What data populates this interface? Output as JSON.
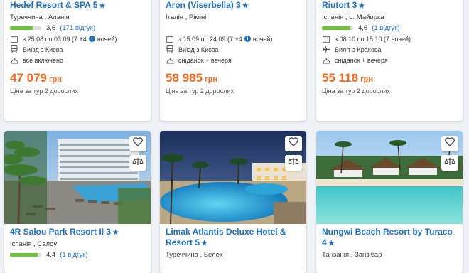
{
  "cards_top": [
    {
      "title": "Hedef Resort & SPA 5",
      "location": "Туреччина , Аланія",
      "rating": "3,6",
      "rating_fraction": 0.72,
      "reviews": "(171 відгук)",
      "dates": "з 25.08 по 03.09 (7 +4",
      "nights": "ночей)",
      "departure": "Виїзд з Києва",
      "meal": "все включено",
      "price": "47 079",
      "currency": "грн",
      "price_note": "Ціна за тур 2 дорослих"
    },
    {
      "title": "Aron (Viserbella) 3",
      "location": "Італія , Ріміні",
      "dates": "з 15.09 по 24.09 (7 +4",
      "nights": "ночей)",
      "departure": "Виїзд з Києва",
      "meal": "сніданок + вечеря",
      "price": "58 985",
      "currency": "грн",
      "price_note": "Ціна за тур 2 дорослих"
    },
    {
      "title": "Riutort 3",
      "location": "Іспанія , о. Майорка",
      "rating": "4,6",
      "rating_fraction": 0.92,
      "reviews": "(1 відгук)",
      "dates": "з 08.10 по 15.10 (7 ночей)",
      "departure": "Виліт з Кракова",
      "meal": "сніданок + вечеря",
      "price": "55 118",
      "currency": "грн",
      "price_note": "Ціна за тур 2 дорослих"
    }
  ],
  "cards_bottom": [
    {
      "title": "4R Salou Park Resort II 3",
      "location": "Іспанія , Салоу",
      "rating": "4,4",
      "rating_fraction": 0.88,
      "reviews": "(1 відгук)"
    },
    {
      "title": "Limak Atlantis Deluxe Hotel & Resort 5",
      "location": "Туреччина , Белек"
    },
    {
      "title": "Nungwi Beach Resort by Turaco 4",
      "location": "Танзанія , Занзібар"
    }
  ],
  "icons": {
    "star": "star-icon",
    "calendar": "calendar-icon",
    "departure_bus": "bus-icon",
    "departure_plane": "plane-icon",
    "meal": "meal-icon",
    "info": "info-icon",
    "favorite": "heart-icon",
    "compare": "scales-icon"
  },
  "colors": {
    "link": "#1f6fbf",
    "price": "#f26a21",
    "rating_fill": "#6cc534"
  }
}
